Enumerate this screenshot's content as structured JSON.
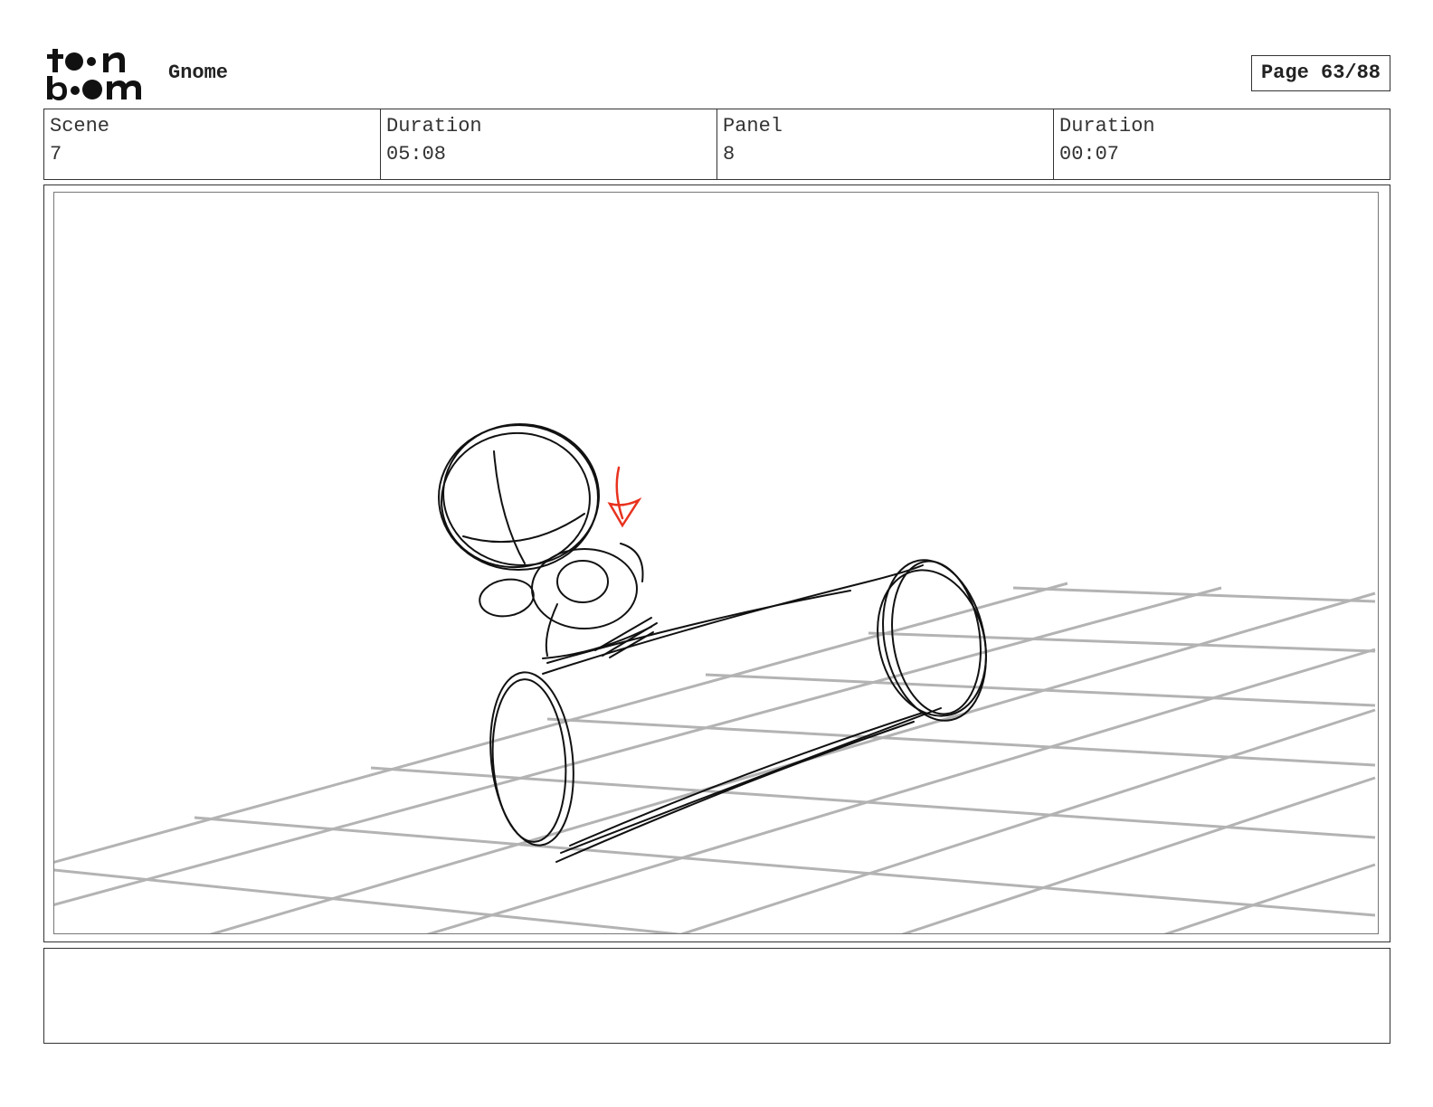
{
  "header": {
    "logo_alt": "toon boom",
    "project_title": "Gnome",
    "page_label": "Page 63/88"
  },
  "info": {
    "scene_label": "Scene",
    "scene_value": "7",
    "scene_duration_label": "Duration",
    "scene_duration_value": "05:08",
    "panel_label": "Panel",
    "panel_value": "8",
    "panel_duration_label": "Duration",
    "panel_duration_value": "00:07"
  },
  "panel": {
    "sketch_line_color": "#111111",
    "grid_color": "#b3b3b3",
    "arrow_color": "#e8321e"
  },
  "notes": {
    "text": ""
  }
}
